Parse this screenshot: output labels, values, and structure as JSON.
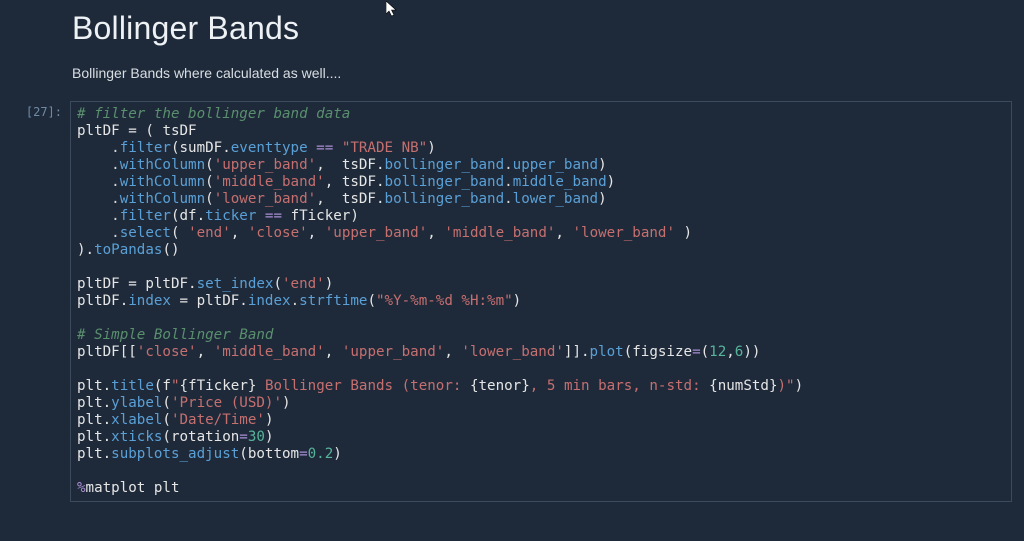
{
  "heading": "Bollinger Bands",
  "subtext": "Bollinger Bands where calculated as well....",
  "prompt": "[27]:",
  "code": {
    "c1": "# filter the bollinger band data",
    "l2_var": "pltDF",
    "l2_eq": " = ( ",
    "l2_rhs": "tsDF",
    "l3_pad": "    .",
    "l3_m": "filter",
    "l3_a": "(sumDF.",
    "l3_evt": "eventtype",
    "l3_eqop": " == ",
    "l3_str": "\"TRADE NB\"",
    "l3_close": ")",
    "l4_pad": "    .",
    "l4_m": "withColumn",
    "l4_open": "(",
    "l4_s": "'upper_band'",
    "l4_comma": ",  ",
    "l4_ts": "tsDF.",
    "l4_bb": "bollinger_band",
    "l4_dot2": ".",
    "l4_fld": "upper_band",
    "l4_close": ")",
    "l5_pad": "    .",
    "l5_m": "withColumn",
    "l5_open": "(",
    "l5_s": "'middle_band'",
    "l5_comma": ", ",
    "l5_ts": "tsDF.",
    "l5_bb": "bollinger_band",
    "l5_dot2": ".",
    "l5_fld": "middle_band",
    "l5_close": ")",
    "l6_pad": "    .",
    "l6_m": "withColumn",
    "l6_open": "(",
    "l6_s": "'lower_band'",
    "l6_comma": ",  ",
    "l6_ts": "tsDF.",
    "l6_bb": "bollinger_band",
    "l6_dot2": ".",
    "l6_fld": "lower_band",
    "l6_close": ")",
    "l7_pad": "    .",
    "l7_m": "filter",
    "l7_open": "(df.",
    "l7_tk": "ticker",
    "l7_eqop": " == ",
    "l7_ft": "fTicker)",
    "l8_pad": "    .",
    "l8_m": "select",
    "l8_open": "( ",
    "l8_s1": "'end'",
    "l8_c1": ", ",
    "l8_s2": "'close'",
    "l8_c2": ", ",
    "l8_s3": "'upper_band'",
    "l8_c3": ", ",
    "l8_s4": "'middle_band'",
    "l8_c4": ", ",
    "l8_s5": "'lower_band'",
    "l8_close": " )",
    "l9_close": ").",
    "l9_m": "toPandas",
    "l9_p": "()",
    "l11_lhs": "pltDF",
    "l11_eq": " = ",
    "l11_rhs": "pltDF.",
    "l11_m": "set_index",
    "l11_open": "(",
    "l11_s": "'end'",
    "l11_close": ")",
    "l12_lhs": "pltDF.",
    "l12_idx": "index",
    "l12_eq": " = ",
    "l12_rhs": "pltDF.",
    "l12_idx2": "index",
    "l12_dot": ".",
    "l12_m": "strftime",
    "l12_open": "(",
    "l12_s": "\"%Y-%m-%d %H:%m\"",
    "l12_close": ")",
    "c2": "# Simple Bollinger Band",
    "l15_lhs": "pltDF[[",
    "l15_s1": "'close'",
    "l15_c1": ", ",
    "l15_s2": "'middle_band'",
    "l15_c2": ", ",
    "l15_s3": "'upper_band'",
    "l15_c3": ", ",
    "l15_s4": "'lower_band'",
    "l15_rb": "]].",
    "l15_m": "plot",
    "l15_open": "(figsize",
    "l15_eqk": "=",
    "l15_tup": "(",
    "l15_n1": "12",
    "l15_comma": ",",
    "l15_n2": "6",
    "l15_close": "))",
    "l17_plt": "plt.",
    "l17_m": "title",
    "l17_open": "(f",
    "l17_q": "\"",
    "l17_b1o": "{",
    "l17_v1": "fTicker",
    "l17_b1c": "}",
    "l17_t1": " Bollinger Bands (tenor: ",
    "l17_b2o": "{",
    "l17_v2": "tenor",
    "l17_b2c": "}",
    "l17_t2": ", 5 min bars, n-std: ",
    "l17_b3o": "{",
    "l17_v3": "numStd",
    "l17_b3c": "}",
    "l17_t3": ")",
    "l17_qc": "\"",
    "l17_close": ")",
    "l18_plt": "plt.",
    "l18_m": "ylabel",
    "l18_open": "(",
    "l18_s": "'Price (USD)'",
    "l18_close": ")",
    "l19_plt": "plt.",
    "l19_m": "xlabel",
    "l19_open": "(",
    "l19_s": "'Date/Time'",
    "l19_close": ")",
    "l20_plt": "plt.",
    "l20_m": "xticks",
    "l20_open": "(rotation",
    "l20_eqk": "=",
    "l20_n": "30",
    "l20_close": ")",
    "l21_plt": "plt.",
    "l21_m": "subplots_adjust",
    "l21_open": "(bottom",
    "l21_eqk": "=",
    "l21_n": "0.2",
    "l21_close": ")",
    "l23_magic": "%",
    "l23_txt": "matplot plt"
  }
}
